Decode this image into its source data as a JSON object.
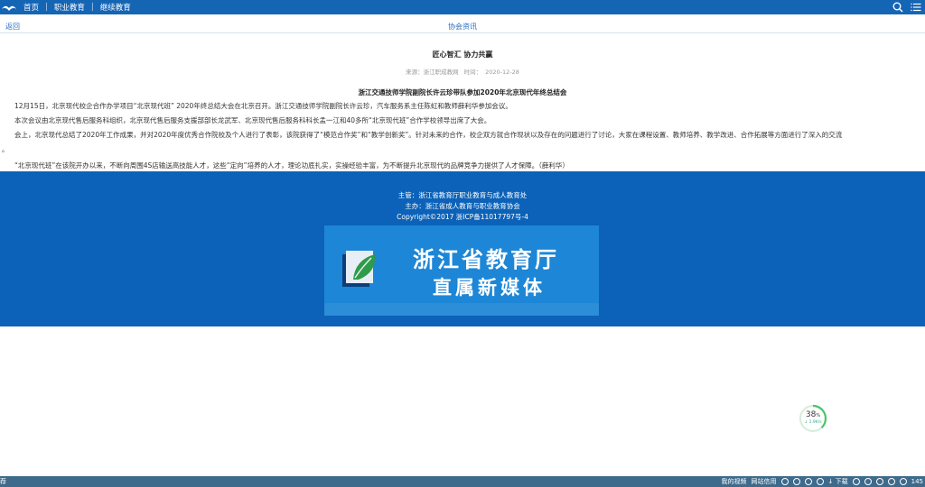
{
  "nav": {
    "home": "首页",
    "vocational": "职业教育",
    "continuing": "继续教育",
    "separator": "|"
  },
  "subbar": {
    "back": "返回",
    "section": "协会资讯"
  },
  "article": {
    "headline": "匠心智汇  协力共赢",
    "source_label": "来源：浙江职成教网",
    "time_label": "时间：",
    "date": "2020-12-28",
    "title": "浙江交通技师学院副院长许云珍带队参加2020年北京现代年终总结会",
    "paragraphs": [
      "12月15日，北京现代校企合作办学项目“北京现代班” 2020年终总结大会在北京召开。浙江交通技师学院副院长许云珍，汽车服务系主任陈虹和教师薛利华参加会议。",
      "本次会议由北京现代售后服务科组织，北京现代售后服务支援部部长龙武军、北京现代售后服务科科长孟一江和40多所“北京现代班”合作学校领导出席了大会。",
      "会上，北京现代总结了2020年工作成果，并对2020年度优秀合作院校及个人进行了表彰，该院获得了“模范合作奖”和“教学创新奖”。针对未来的合作，校企双方就合作现状以及存在的问题进行了讨论，大家在课程设置、教师培养、教学改进、合作拓展等方面进行了深入的交流",
      "。",
      "“北京现代班”在该院开办以来，不断向周围4S店输送高技能人才，这些“定向”培养的人才，理论功底扎实，实操经验丰富，为不断提升北京现代的品牌竞争力提供了人才保障。（薛利华）"
    ]
  },
  "footer": {
    "sponsor": "主管：浙江省教育厅职业教育与成人教育处",
    "organizer": "主办：浙江省成人教育与职业教育协会",
    "copyright": "Copyright©2017 浙ICP备11017797号-4",
    "banner_line1": "浙江省教育厅",
    "banner_line2": "直属新媒体"
  },
  "progress_widget": {
    "percent": "38",
    "percent_sign": "%",
    "speed": "↓ 1.9K/s"
  },
  "taskbar": {
    "left_label": "荐",
    "my_video": "我的视频",
    "net_bank": "网站信用",
    "download": "下载",
    "zoom": "145"
  },
  "colors": {
    "brand_blue": "#1565b5",
    "footer_blue": "#0b62b8",
    "link_blue": "#2a6fbf",
    "progress_green": "#4cc46a"
  }
}
